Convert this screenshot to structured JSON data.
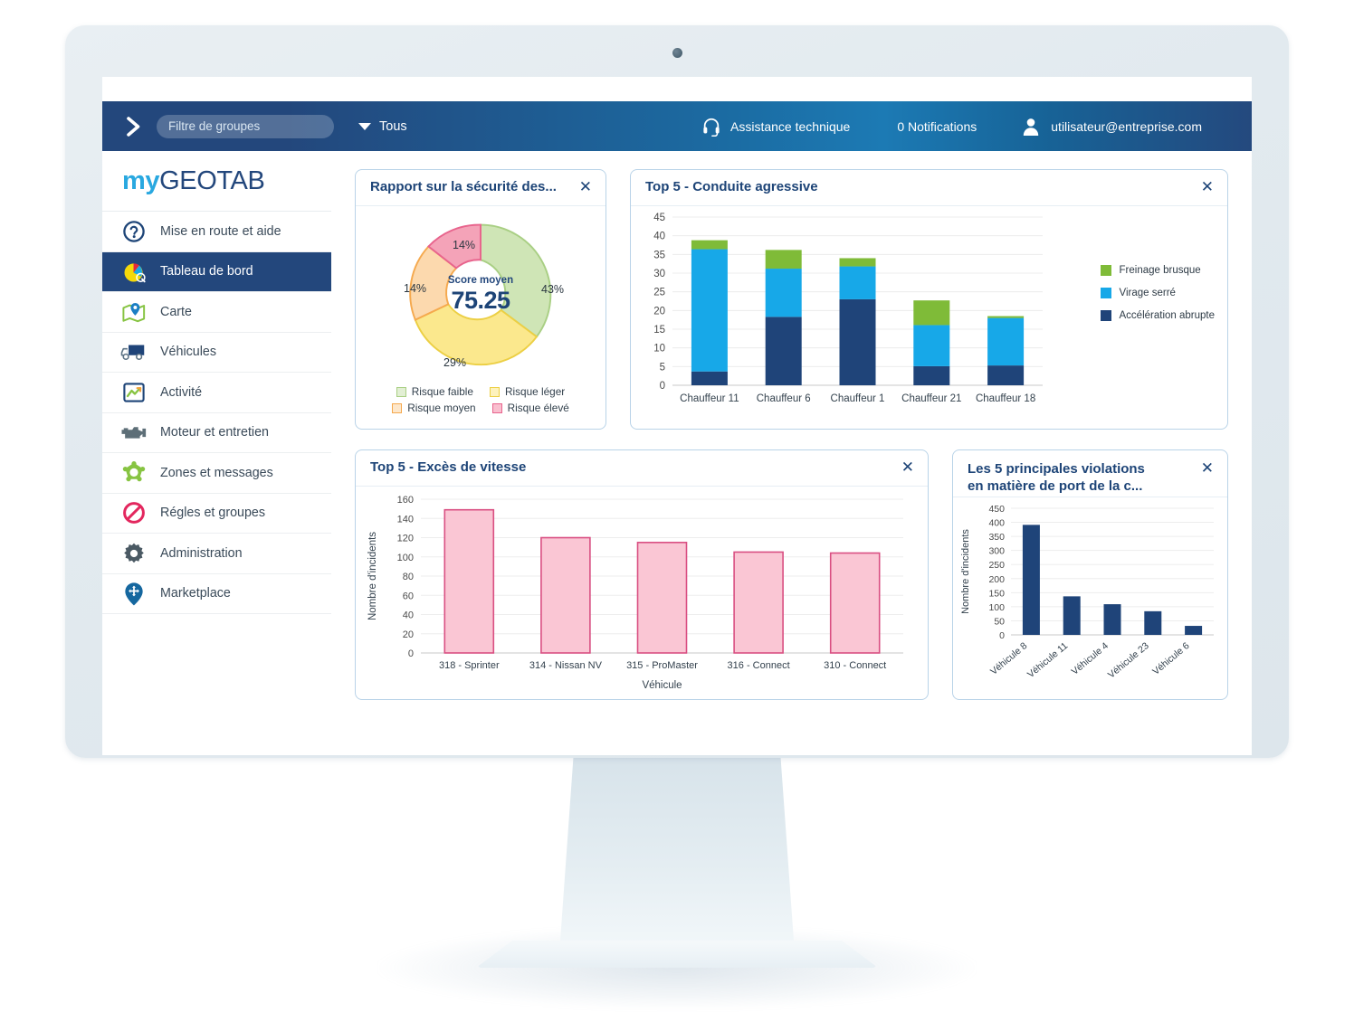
{
  "topbar": {
    "chevron_icon": "chevron-right-icon",
    "group_filter_placeholder": "Filtre de groupes",
    "group_filter_value": "",
    "all_label": "Tous",
    "support_label": "Assistance technique",
    "support_icon": "headset-icon",
    "notifications_label": "0 Notifications",
    "user_email": "utilisateur@entreprise.com",
    "user_icon": "user-icon"
  },
  "brand": {
    "prefix": "my",
    "suffix": "GEOTAB"
  },
  "sidebar": {
    "items": [
      {
        "label": "Mise en route et aide",
        "icon": "question-circle-icon",
        "active": false
      },
      {
        "label": "Tableau de bord",
        "icon": "pie-chart-icon",
        "active": true
      },
      {
        "label": "Carte",
        "icon": "map-pin-icon",
        "active": false
      },
      {
        "label": "Véhicules",
        "icon": "truck-icon",
        "active": false
      },
      {
        "label": "Activité",
        "icon": "trend-chart-icon",
        "active": false
      },
      {
        "label": "Moteur et entretien",
        "icon": "engine-icon",
        "active": false
      },
      {
        "label": "Zones et messages",
        "icon": "zone-gear-icon",
        "active": false
      },
      {
        "label": "Régles et groupes",
        "icon": "no-entry-icon",
        "active": false
      },
      {
        "label": "Administration",
        "icon": "gear-icon",
        "active": false
      },
      {
        "label": "Marketplace",
        "icon": "marketplace-pin-icon",
        "active": false
      }
    ]
  },
  "widgets": {
    "safety": {
      "title": "Rapport sur la sécurité des...",
      "close_label": "✕"
    },
    "aggressive": {
      "title": "Top 5 - Conduite agressive",
      "close_label": "✕"
    },
    "speeding": {
      "title": "Top 5 - Excès de vitesse",
      "close_label": "✕"
    },
    "seatbelt": {
      "title_line1": "Les 5 principales violations",
      "title_line2": "en matière de port de la c...",
      "close_label": "✕"
    }
  },
  "chart_data": [
    {
      "id": "safety-donut",
      "type": "pie",
      "title": "Rapport sur la sécurité des...",
      "center_label": "Score moyen",
      "center_value": "75.25",
      "legend_position": "bottom",
      "categories": [
        "Risque faible",
        "Risque léger",
        "Risque moyen",
        "Risque élevé"
      ],
      "values": [
        43,
        29,
        14,
        14
      ],
      "value_labels": [
        "43%",
        "29%",
        "14%",
        "14%"
      ],
      "colors": [
        "#cfe5b6",
        "#fbe88d",
        "#fcd9ae",
        "#f4a3b8"
      ],
      "stroke_colors": [
        "#9ec97a",
        "#e8c93f",
        "#f3a martial",
        "#e8648d"
      ]
    },
    {
      "id": "aggressive-stacked",
      "type": "bar",
      "stacked": true,
      "title": "Top 5 - Conduite agressive",
      "xlabel": "",
      "ylabel": "",
      "ylim": [
        0,
        45
      ],
      "yticks": [
        0,
        5,
        10,
        15,
        20,
        25,
        30,
        35,
        40,
        45
      ],
      "grid": true,
      "legend_position": "right",
      "categories": [
        "Chauffeur 11",
        "Chauffeur 6",
        "Chauffeur 1",
        "Chauffeur 21",
        "Chauffeur 18"
      ],
      "series": [
        {
          "name": "Accélération abrupte",
          "color": "#1f4479",
          "values": [
            3.7,
            18.3,
            23.0,
            5.1,
            5.3
          ]
        },
        {
          "name": "Virage serré",
          "color": "#17a8e8",
          "values": [
            32.7,
            12.9,
            8.8,
            11.0,
            12.7
          ]
        },
        {
          "name": "Freinage brusque",
          "color": "#7fbb38",
          "values": [
            2.4,
            5.0,
            2.2,
            6.6,
            0.5
          ]
        }
      ],
      "legend_order": [
        "Freinage brusque",
        "Virage serré",
        "Accélération abrupte"
      ]
    },
    {
      "id": "speeding-bar",
      "type": "bar",
      "title": "Top 5 - Excès de vitesse",
      "xlabel": "Véhicule",
      "ylabel": "Nombre d'incidents",
      "ylim": [
        0,
        160
      ],
      "yticks": [
        0,
        20,
        40,
        60,
        80,
        100,
        120,
        140,
        160
      ],
      "grid": true,
      "categories": [
        "318 - Sprinter",
        "314 - Nissan NV",
        "315 - ProMaster",
        "316 - Connect",
        "310 - Connect"
      ],
      "values": [
        149,
        120,
        115,
        105,
        104
      ],
      "bar_color": "#fac6d4",
      "bar_edge_color": "#d94f82"
    },
    {
      "id": "seatbelt-bar",
      "type": "bar",
      "title": "Les 5 principales violations en matière de port de la c...",
      "xlabel": "",
      "ylabel": "Nombre d'incidents",
      "ylim": [
        0,
        450
      ],
      "yticks": [
        0,
        50,
        100,
        150,
        200,
        250,
        300,
        350,
        400,
        450
      ],
      "grid": true,
      "categories": [
        "Véhicule 8",
        "Véhicule 11",
        "Véhicule 4",
        "Véhicule 23",
        "Véhicule 6"
      ],
      "values": [
        391,
        137,
        109,
        84,
        32
      ],
      "bar_color": "#1f4479"
    }
  ]
}
